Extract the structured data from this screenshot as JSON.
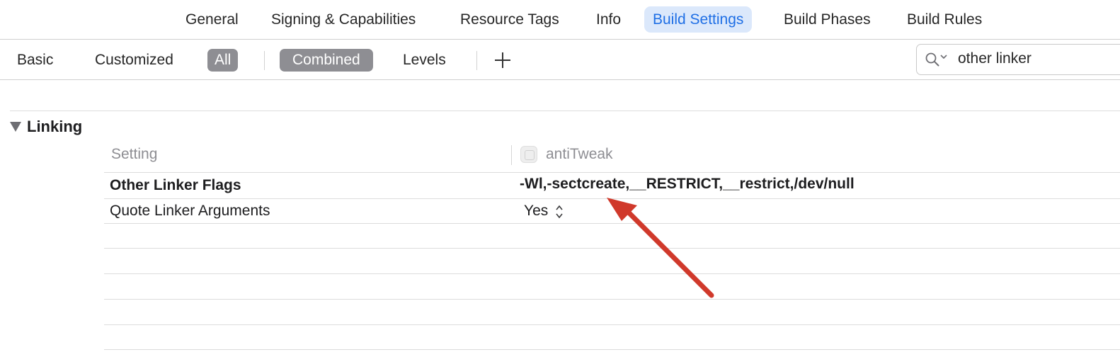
{
  "tabs": [
    {
      "label": "General",
      "active": false
    },
    {
      "label": "Signing & Capabilities",
      "active": false
    },
    {
      "label": "Resource Tags",
      "active": false
    },
    {
      "label": "Info",
      "active": false
    },
    {
      "label": "Build Settings",
      "active": true
    },
    {
      "label": "Build Phases",
      "active": false
    },
    {
      "label": "Build Rules",
      "active": false
    }
  ],
  "filter_bar": {
    "scope": [
      "Basic",
      "Customized",
      "All"
    ],
    "scope_selected": "All",
    "view": [
      "Combined",
      "Levels"
    ],
    "view_selected": "Combined",
    "add_icon": "plus-icon"
  },
  "search": {
    "value": "other linker",
    "icon": "magnifying-glass-icon"
  },
  "section": {
    "title": "Linking",
    "expanded": true
  },
  "columns": {
    "setting": "Setting",
    "target": "antiTweak",
    "target_icon": "app-target-icon"
  },
  "rows": [
    {
      "label": "Other Linker Flags",
      "value": "-Wl,-sectcreate,__RESTRICT,__restrict,/dev/null",
      "bold": true
    },
    {
      "label": "Quote Linker Arguments",
      "value": "Yes",
      "bold": false
    }
  ],
  "colors": {
    "accent": "#1f6fe5",
    "active_tab_bg": "#dbe8fb",
    "segment_selected": "#8e8e93",
    "annotation_arrow": "#d0392b"
  }
}
